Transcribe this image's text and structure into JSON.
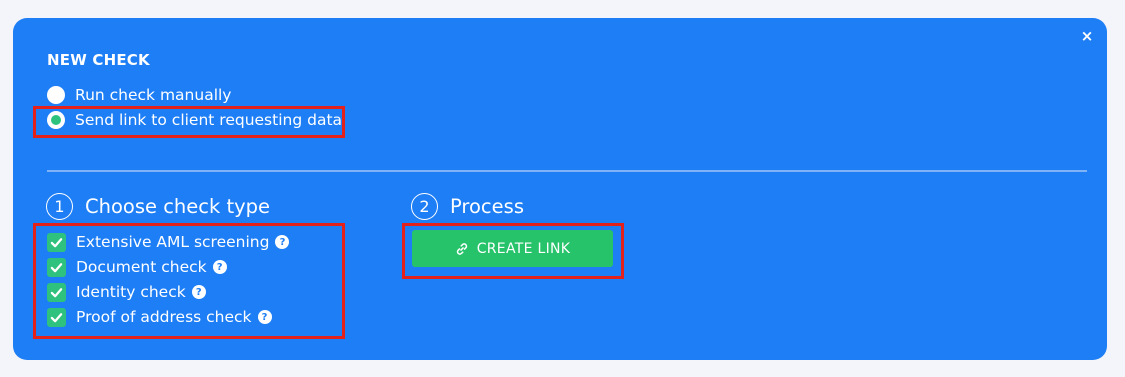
{
  "dialog": {
    "title": "NEW CHECK",
    "close_glyph": "×",
    "run_mode": {
      "options": [
        {
          "label": "Run check manually",
          "selected": false
        },
        {
          "label": "Send link to client requesting data",
          "selected": true
        }
      ]
    },
    "step1": {
      "number": "1",
      "heading": "Choose check type",
      "checks": [
        {
          "label": "Extensive AML screening",
          "checked": true,
          "help": "?"
        },
        {
          "label": "Document check",
          "checked": true,
          "help": "?"
        },
        {
          "label": "Identity check",
          "checked": true,
          "help": "?"
        },
        {
          "label": "Proof of address check",
          "checked": true,
          "help": "?"
        }
      ]
    },
    "step2": {
      "number": "2",
      "heading": "Process",
      "button_label": "CREATE LINK",
      "button_icon": "link-icon"
    }
  },
  "colors": {
    "panel": "#1e7ef5",
    "accent_green": "#27c36a",
    "highlight_red": "#e4221b"
  }
}
